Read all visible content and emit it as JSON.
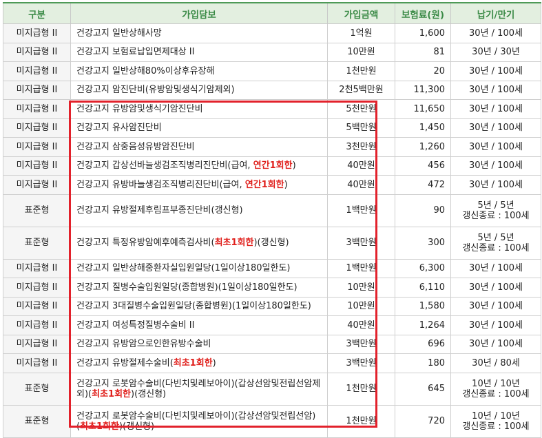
{
  "header": {
    "type": "구분",
    "coverage": "가입담보",
    "amount": "가입금액",
    "premium": "보험료(원)",
    "term": "납기/만기"
  },
  "rows": [
    {
      "type": "미지급형 II",
      "coverage": "건강고지 일반상해사망",
      "amount": "1억원",
      "premium": "1,600",
      "term": "30년 / 100세"
    },
    {
      "type": "미지급형 II",
      "coverage": "건강고지 보험료납입면제대상 II",
      "amount": "10만원",
      "premium": "81",
      "term": "30년 / 30년"
    },
    {
      "type": "미지급형 II",
      "coverage": "건강고지 일반상해80%이상후유장해",
      "amount": "1천만원",
      "premium": "20",
      "term": "30년 / 100세"
    },
    {
      "type": "미지급형 II",
      "coverage": "건강고지 암진단비(유방암및생식기암제외)",
      "amount": "2천5백만원",
      "premium": "11,300",
      "term": "30년 / 100세"
    },
    {
      "type": "미지급형 II",
      "coverage": "건강고지 유방암및생식기암진단비",
      "amount": "5천만원",
      "premium": "11,650",
      "term": "30년 / 100세"
    },
    {
      "type": "미지급형 II",
      "coverage": "건강고지 유사암진단비",
      "amount": "5백만원",
      "premium": "1,450",
      "term": "30년 / 100세"
    },
    {
      "type": "미지급형 II",
      "coverage": "건강고지 삼중음성유방암진단비",
      "amount": "3천만원",
      "premium": "1,260",
      "term": "30년 / 100세"
    },
    {
      "type": "미지급형 II",
      "coverage_pre": "건강고지 갑상선바늘생검조직병리진단비(급여, ",
      "coverage_hl": "연간1회한",
      "coverage_post": ")",
      "amount": "40만원",
      "premium": "456",
      "term": "30년 / 100세"
    },
    {
      "type": "미지급형 II",
      "coverage_pre": "건강고지 유방바늘생검조직병리진단비(급여, ",
      "coverage_hl": "연간1회한",
      "coverage_post": ")",
      "amount": "40만원",
      "premium": "472",
      "term": "30년 / 100세"
    },
    {
      "type": "표준형",
      "coverage": "건강고지 유방절제후림프부종진단비(갱신형)",
      "amount": "1백만원",
      "premium": "90",
      "term1": "5년 / 5년",
      "term2": "갱신종료 : 100세"
    },
    {
      "type": "표준형",
      "coverage_pre": "건강고지 특정유방암예후예측검사비(",
      "coverage_hl": "최초1회한",
      "coverage_post": ")(갱신형)",
      "amount": "3백만원",
      "premium": "300",
      "term1": "5년 / 5년",
      "term2": "갱신종료 : 100세"
    },
    {
      "type": "미지급형 II",
      "coverage": "건강고지 일반상해중환자실입원일당(1일이상180일한도)",
      "amount": "1백만원",
      "premium": "6,300",
      "term": "30년 / 100세"
    },
    {
      "type": "미지급형 II",
      "coverage": "건강고지 질병수술입원일당(종합병원)(1일이상180일한도)",
      "amount": "10만원",
      "premium": "6,110",
      "term": "30년 / 100세"
    },
    {
      "type": "미지급형 II",
      "coverage": "건강고지 3대질병수술입원일당(종합병원)(1일이상180일한도)",
      "amount": "10만원",
      "premium": "1,580",
      "term": "30년 / 100세"
    },
    {
      "type": "미지급형 II",
      "coverage": "건강고지 여성특정질병수술비 II",
      "amount": "40만원",
      "premium": "1,264",
      "term": "30년 / 100세"
    },
    {
      "type": "미지급형 II",
      "coverage": "건강고지 유방암으로인한유방수술비",
      "amount": "3백만원",
      "premium": "696",
      "term": "30년 / 100세"
    },
    {
      "type": "미지급형 II",
      "coverage_pre": "건강고지 유방절제수술비(",
      "coverage_hl": "최초1회한",
      "coverage_post": ")",
      "amount": "3백만원",
      "premium": "180",
      "term": "30년 / 80세"
    },
    {
      "type": "표준형",
      "coverage_pre": "건강고지 로봇암수술비(다빈치및레보아이)(갑상선암및전립선암제외)(",
      "coverage_hl": "최초1회한",
      "coverage_post": ")(갱신형)",
      "amount": "1천만원",
      "premium": "645",
      "term1": "10년 / 10년",
      "term2": "갱신종료 : 100세"
    },
    {
      "type": "표준형",
      "coverage_pre": "건강고지 로봇암수술비(다빈치및레보아이)(갑상선암및전립선암)(",
      "coverage_hl": "최초1회한",
      "coverage_post": ")(갱신형)",
      "amount": "1천만원",
      "premium": "720",
      "term1": "10년 / 10년",
      "term2": "갱신종료 : 100세"
    }
  ],
  "accent": {
    "header_bg": "#e3efe0",
    "header_text": "#3a8a46",
    "highlight": "#e0201c",
    "box": "#e2212b"
  }
}
